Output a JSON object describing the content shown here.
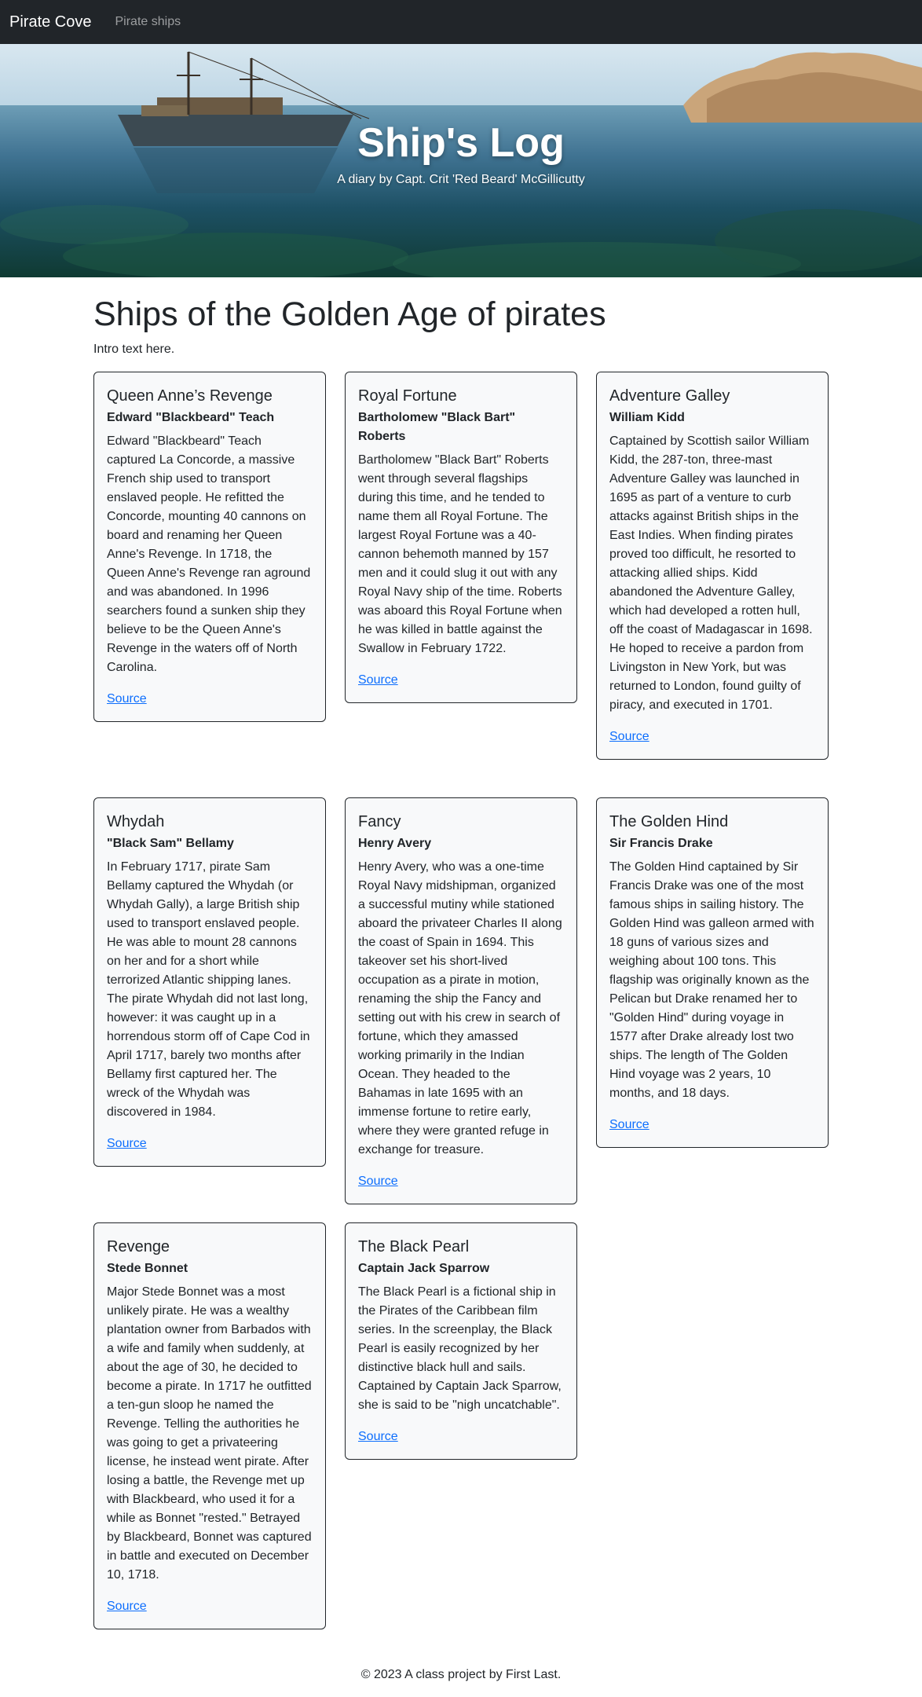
{
  "navbar": {
    "brand": "Pirate Cove",
    "link": "Pirate ships"
  },
  "hero": {
    "title": "Ship's Log",
    "subtitle": "A diary by Capt. Crit 'Red Beard' McGillicutty"
  },
  "main": {
    "title": "Ships of the Golden Age of pirates",
    "intro": "Intro text here.",
    "source_label": "Source",
    "cards": [
      {
        "ship": "Queen Anne’s Revenge",
        "captain": "Edward \"Blackbeard\" Teach",
        "text": "Edward \"Blackbeard\" Teach captured La Concorde, a massive French ship used to transport enslaved people. He refitted the Concorde, mounting 40 cannons on board and renaming her Queen Anne's Revenge. In 1718, the Queen Anne's Revenge ran aground and was abandoned. In 1996 searchers found a sunken ship they believe to be the Queen Anne's Revenge in the waters off of North Carolina."
      },
      {
        "ship": "Royal Fortune",
        "captain": "Bartholomew \"Black Bart\" Roberts",
        "text": "Bartholomew \"Black Bart\" Roberts went through several flagships during this time, and he tended to name them all Royal Fortune. The largest Royal Fortune was a 40-cannon behemoth manned by 157 men and it could slug it out with any Royal Navy ship of the time. Roberts was aboard this Royal Fortune when he was killed in battle against the Swallow in February 1722."
      },
      {
        "ship": "Adventure Galley",
        "captain": "William Kidd",
        "text": "Captained by Scottish sailor William Kidd, the 287-ton, three-mast Adventure Galley was launched in 1695 as part of a venture to curb attacks against British ships in the East Indies. When finding pirates proved too difficult, he resorted to attacking allied ships. Kidd abandoned the Adventure Galley, which had developed a rotten hull, off the coast of Madagascar in 1698. He hoped to receive a pardon from Livingston in New York, but was returned to London, found guilty of piracy, and executed in 1701."
      },
      {
        "ship": "Whydah",
        "captain": "\"Black Sam\" Bellamy",
        "text": "In February 1717, pirate Sam Bellamy captured the Whydah (or Whydah Gally), a large British ship used to transport enslaved people. He was able to mount 28 cannons on her and for a short while terrorized Atlantic shipping lanes. The pirate Whydah did not last long, however: it was caught up in a horrendous storm off of Cape Cod in April 1717, barely two months after Bellamy first captured her. The wreck of the Whydah was discovered in 1984."
      },
      {
        "ship": "Fancy",
        "captain": "Henry Avery",
        "text": "Henry Avery, who was a one-time Royal Navy midshipman, organized a successful mutiny while stationed aboard the privateer Charles II along the coast of Spain in 1694. This takeover set his short-lived occupation as a pirate in motion, renaming the ship the Fancy and setting out with his crew in search of fortune, which they amassed working primarily in the Indian Ocean. They headed to the Bahamas in late 1695 with an immense fortune to retire early, where they were granted refuge in exchange for treasure."
      },
      {
        "ship": "The Golden Hind",
        "captain": "Sir Francis Drake",
        "text": "The Golden Hind captained by Sir Francis Drake was one of the most famous ships in sailing history. The Golden Hind was galleon armed with 18 guns of various sizes and weighing about 100 tons. This flagship was originally known as the Pelican but Drake renamed her to \"Golden Hind\" during voyage in 1577 after Drake already lost two ships. The length of The Golden Hind voyage was 2 years, 10 months, and 18 days."
      },
      {
        "ship": "Revenge",
        "captain": "Stede Bonnet",
        "text": "Major Stede Bonnet was a most unlikely pirate. He was a wealthy plantation owner from Barbados with a wife and family when suddenly, at about the age of 30, he decided to become a pirate. In 1717 he outfitted a ten-gun sloop he named the Revenge. Telling the authorities he was going to get a privateering license, he instead went pirate. After losing a battle, the Revenge met up with Blackbeard, who used it for a while as Bonnet \"rested.\" Betrayed by Blackbeard, Bonnet was captured in battle and executed on December 10, 1718."
      },
      {
        "ship": "The Black Pearl",
        "captain": "Captain Jack Sparrow",
        "text": "The Black Pearl is a fictional ship in the Pirates of the Caribbean film series. In the screenplay, the Black Pearl is easily recognized by her distinctive black hull and sails. Captained by Captain Jack Sparrow, she is said to be \"nigh uncatchable\"."
      }
    ]
  },
  "footer": {
    "text": "© 2023 A class project by First Last."
  }
}
